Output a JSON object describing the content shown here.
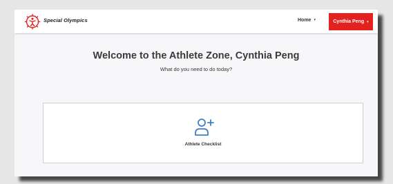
{
  "brand": {
    "name": "Special Olympics",
    "logo_icon": "special-olympics-logo-icon",
    "logo_color": "#e3221f"
  },
  "navbar": {
    "home_label": "Home",
    "user_label": "Cynthia Peng",
    "dropdown_icon": "chevron-down-icon",
    "user_button_color": "#e3221f"
  },
  "main": {
    "welcome_title": "Welcome to the Athlete Zone, Cynthia Peng",
    "subtitle": "What do you need to do today?"
  },
  "cards": [
    {
      "label": "Athlete Checklist",
      "icon": "add-user-icon",
      "icon_color": "#3d7fc4"
    }
  ]
}
